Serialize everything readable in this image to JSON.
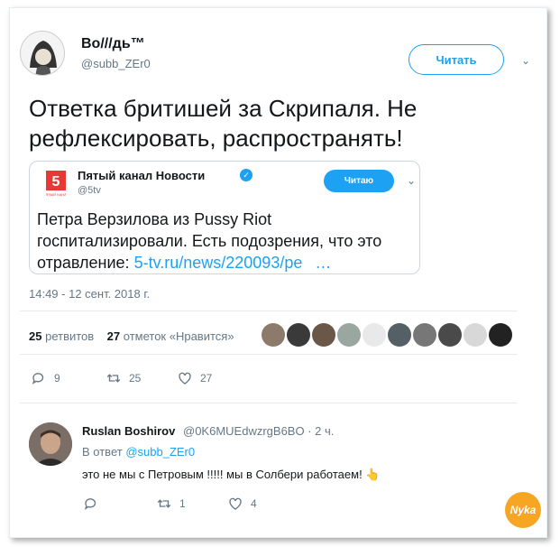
{
  "tweet": {
    "author_name": "Во///дь™",
    "author_handle": "@subb_ZEr0",
    "follow_label": "Читать",
    "text": "Ответка бритишей за Скрипаля. Не рефлексировать, распространять!",
    "timestamp": "14:49 - 12 сент. 2018 г.",
    "retweets_count": "25",
    "retweets_label": "ретвитов",
    "likes_count": "27",
    "likes_label": "отметок «Нравится»",
    "actions": {
      "replies": "9",
      "retweets": "25",
      "likes": "27"
    }
  },
  "quote": {
    "author_name": "Пятый канал Новости",
    "author_handle": "@5tv",
    "follow_label": "Читаю",
    "text": "Петра Верзилова из Pussy Riot госпитализировали. Есть подозрения, что это отравление: ",
    "link": "5-tv.ru/news/220093/ре",
    "link_ellipsis": "…",
    "logo_number": "5",
    "logo_caption": "ПЯТЫЙ КАНАЛ"
  },
  "reply": {
    "author_name": "Ruslan Boshirov",
    "meta": "@0K6MUEdwzrgB6BO · 2 ч.",
    "reply_to_prefix": "В ответ",
    "reply_to_handle": "@subb_ZEr0",
    "text": "это не мы  с Петровым  !!!!! мы в Солбери работаем! 👆",
    "actions": {
      "replies": "",
      "retweets": "1",
      "likes": "4"
    }
  },
  "watermark": "Nyka",
  "colors": {
    "accent": "#1da1f2",
    "muted": "#657786",
    "text": "#14171a"
  }
}
